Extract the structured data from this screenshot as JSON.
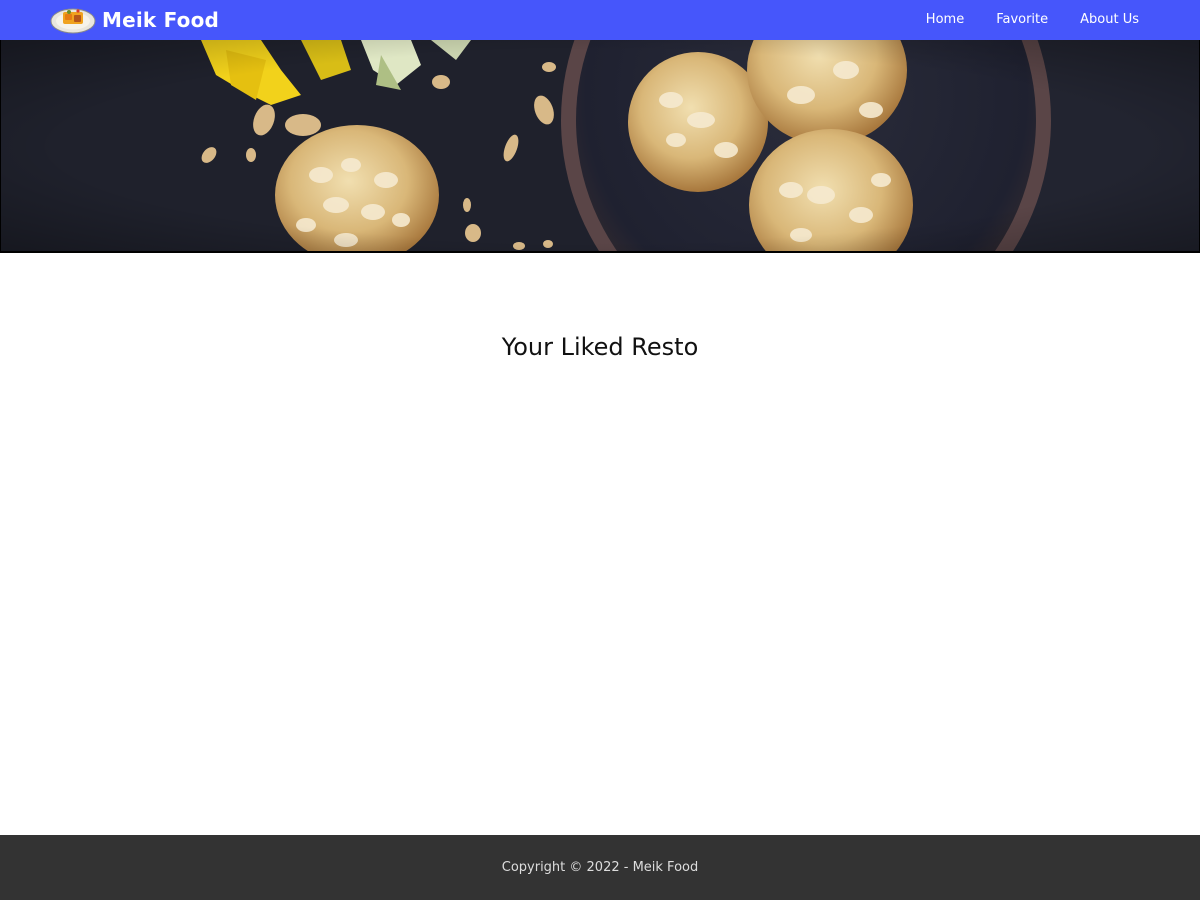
{
  "header": {
    "brand_name": "Meik Food",
    "logo_icon": "food-plate-logo",
    "nav": [
      {
        "label": "Home"
      },
      {
        "label": "Favorite"
      },
      {
        "label": "About Us"
      }
    ],
    "background_color": "#4656fb"
  },
  "hero": {
    "image_description_icon": "cookies-hero-image"
  },
  "main": {
    "title": "Your Liked Resto"
  },
  "footer": {
    "copyright": "Copyright © 2022 - Meik Food",
    "background_color": "#333333"
  }
}
